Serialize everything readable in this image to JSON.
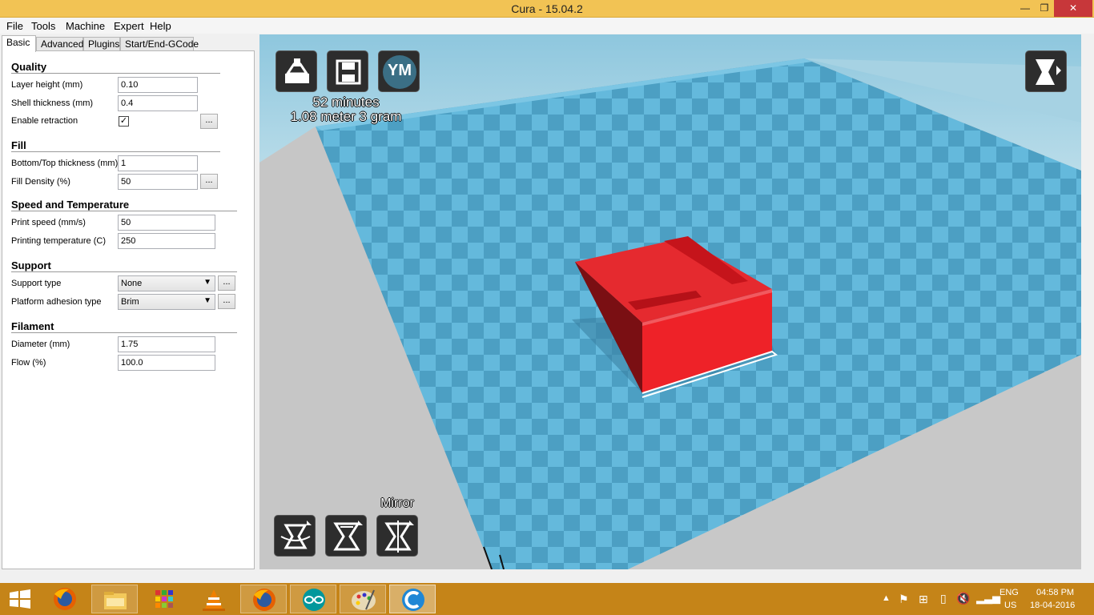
{
  "window": {
    "title": "Cura - 15.04.2",
    "minimize": "—",
    "maximize": "❐",
    "close": "✕"
  },
  "menu": [
    "File",
    "Tools",
    "Machine",
    "Expert",
    "Help"
  ],
  "tabs": [
    "Basic",
    "Advanced",
    "Plugins",
    "Start/End-GCode"
  ],
  "settings": {
    "quality": {
      "header": "Quality",
      "layer_height_label": "Layer height (mm)",
      "layer_height": "0.10",
      "shell_thickness_label": "Shell thickness (mm)",
      "shell_thickness": "0.4",
      "retraction_label": "Enable retraction",
      "retraction_checked": "✓"
    },
    "fill": {
      "header": "Fill",
      "bottom_top_label": "Bottom/Top thickness (mm)",
      "bottom_top": "1",
      "density_label": "Fill Density (%)",
      "density": "50"
    },
    "speed": {
      "header": "Speed and Temperature",
      "print_speed_label": "Print speed (mm/s)",
      "print_speed": "50",
      "temp_label": "Printing temperature (C)",
      "temp": "250"
    },
    "support": {
      "header": "Support",
      "type_label": "Support type",
      "type": "None",
      "adhesion_label": "Platform adhesion type",
      "adhesion": "Brim"
    },
    "filament": {
      "header": "Filament",
      "diameter_label": "Diameter (mm)",
      "diameter": "1.75",
      "flow_label": "Flow (%)",
      "flow": "100.0"
    },
    "more_button": "..."
  },
  "viewport": {
    "print_time": "52 minutes",
    "material": "1.08 meter 3 gram",
    "ym_button": "YM",
    "mirror_label": "Mirror",
    "colors": {
      "grid_light": "#64b9dc",
      "grid_dark": "#4c9fc3",
      "model": "#e8212a"
    }
  },
  "taskbar": {
    "lang": "ENG",
    "region": "US",
    "time": "04:58 PM",
    "date": "18-04-2016",
    "apps": [
      "windows-logo",
      "firefox",
      "file-explorer",
      "store",
      "vlc",
      "firefox",
      "arduino",
      "paint",
      "cura"
    ]
  }
}
